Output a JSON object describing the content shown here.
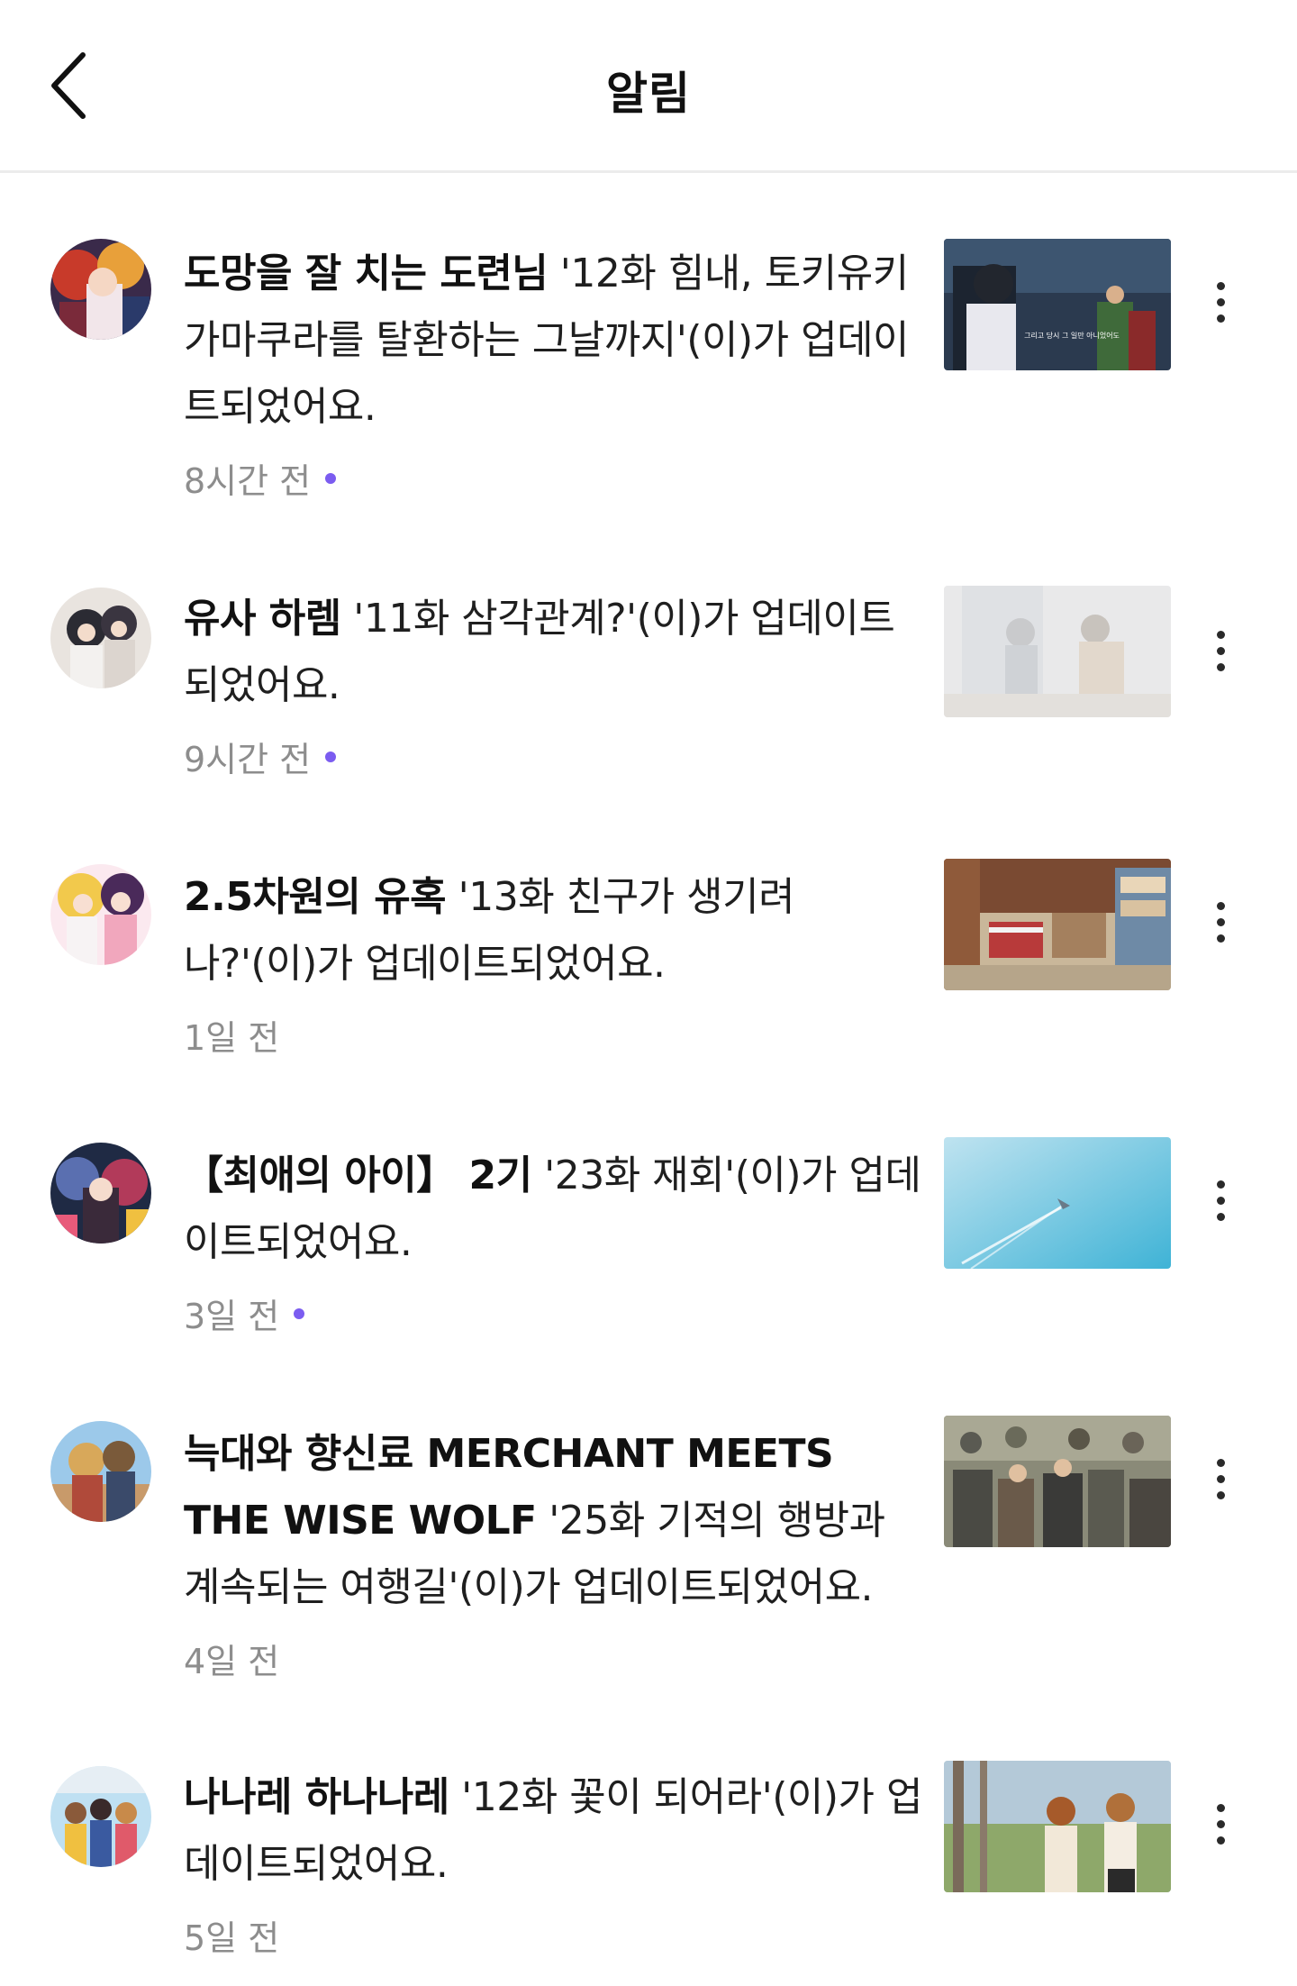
{
  "header": {
    "title": "알림",
    "back_icon": "chevron-left-icon"
  },
  "notifications": [
    {
      "series": "도망을 잘 치는 도련님",
      "message": " '12화 힘내, 토키유키 가마쿠라를 탈환하는 그날까지'(이)가 업데이트되었어요.",
      "time": "8시간 전",
      "unread": true,
      "thumbnail_caption": "그리고 당시 그 일만 아니었어도"
    },
    {
      "series": "유사 하렘",
      "message": " '11화 삼각관계?'(이)가 업데이트되었어요.",
      "time": "9시간 전",
      "unread": true,
      "thumbnail_caption": ""
    },
    {
      "series": "2.5차원의 유혹",
      "message": " '13화 친구가 생기려나?'(이)가 업데이트되었어요.",
      "time": "1일 전",
      "unread": false,
      "thumbnail_caption": ""
    },
    {
      "series": "【최애의 아이】 2기",
      "message": " '23화 재회'(이)가 업데이트되었어요.",
      "time": "3일 전",
      "unread": true,
      "thumbnail_caption": ""
    },
    {
      "series": "늑대와 향신료 MERCHANT MEETS THE WISE WOLF",
      "message": " '25화 기적의 행방과 계속되는 여행길'(이)가 업데이트되었어요.",
      "time": "4일 전",
      "unread": false,
      "thumbnail_caption": ""
    },
    {
      "series": "나나레 하나나레",
      "message": " '12화 꽃이 되어라'(이)가 업데이트되었어요.",
      "time": "5일 전",
      "unread": false,
      "thumbnail_caption": ""
    }
  ],
  "colors": {
    "unread_dot": "#7b5cf0",
    "meta_text": "#8d8d8d",
    "divider": "#ececec"
  }
}
